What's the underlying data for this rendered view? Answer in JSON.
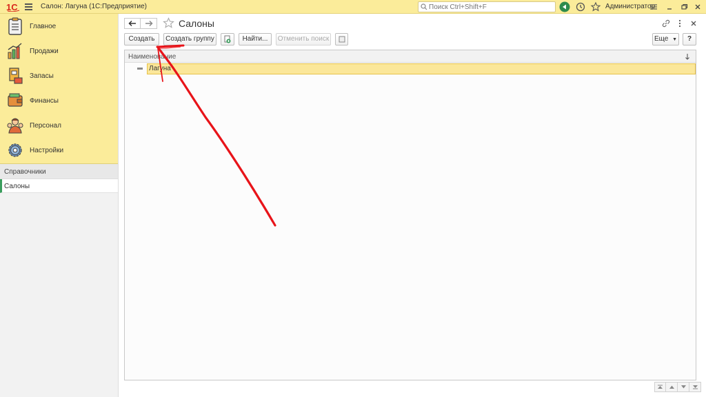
{
  "titlebar": {
    "app_title": "Салон: Лагуна  (1С:Предприятие)",
    "search_placeholder": "Поиск Ctrl+Shift+F",
    "user_name": "Администратор"
  },
  "sidebar": {
    "sections": [
      {
        "label": "Главное",
        "icon": "clipboard-icon"
      },
      {
        "label": "Продажи",
        "icon": "sales-chart-icon"
      },
      {
        "label": "Запасы",
        "icon": "inventory-icon"
      },
      {
        "label": "Финансы",
        "icon": "wallet-icon"
      },
      {
        "label": "Персонал",
        "icon": "staff-icon"
      },
      {
        "label": "Настройки",
        "icon": "gear-icon"
      }
    ],
    "subgroup_title": "Справочники",
    "subitems": [
      "Салоны"
    ]
  },
  "form": {
    "title": "Салоны",
    "buttons": {
      "create": "Создать",
      "create_group": "Создать группу",
      "find": "Найти...",
      "cancel_search": "Отменить поиск",
      "more": "Еще",
      "help": "?"
    }
  },
  "table": {
    "column_header": "Наименование",
    "rows": [
      "Лагуна"
    ]
  },
  "colors": {
    "accent_yellow": "#fbec9a",
    "selection": "#fbe79a",
    "annotation_red": "#e8141a"
  }
}
